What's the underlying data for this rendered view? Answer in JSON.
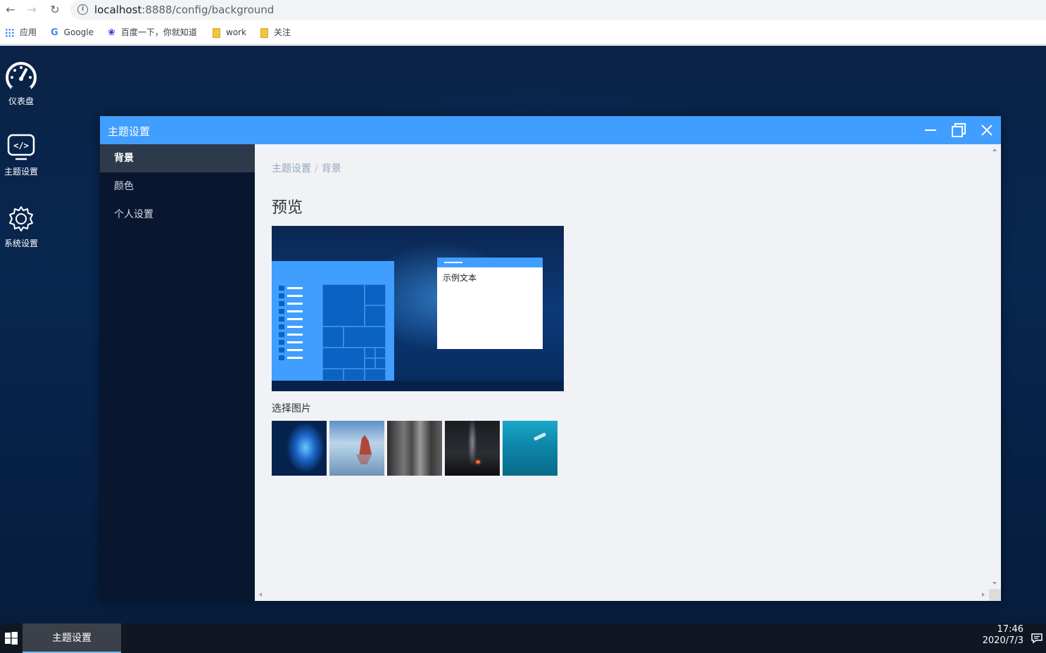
{
  "browser": {
    "url_host": "localhost",
    "url_rest": ":8888/config/background",
    "bookmarks": [
      "应用",
      "Google",
      "百度一下，你就知道",
      "work",
      "关注"
    ]
  },
  "desktop": {
    "icons": [
      {
        "label": "仪表盘",
        "icon": "dashboard-icon"
      },
      {
        "label": "主题设置",
        "icon": "code-icon"
      },
      {
        "label": "系统设置",
        "icon": "gear-icon"
      }
    ]
  },
  "window": {
    "title": "主题设置",
    "sidebar": {
      "items": [
        {
          "label": "背景",
          "active": true
        },
        {
          "label": "颜色",
          "active": false
        },
        {
          "label": "个人设置",
          "active": false
        }
      ]
    },
    "breadcrumb": {
      "root": "主题设置",
      "sep": "/",
      "current": "背景"
    },
    "preview_title": "预览",
    "preview_window_text": "示例文本",
    "choose_label": "选择图片",
    "thumbnails": [
      "windows-blue-wallpaper",
      "red-rock-beach-wallpaper",
      "grey-rock-wallpaper",
      "milky-way-campfire-wallpaper",
      "underwater-diver-wallpaper"
    ]
  },
  "taskbar": {
    "task_label": "主题设置",
    "time": "17:46",
    "date": "2020/7/3"
  },
  "colors": {
    "accent": "#409eff",
    "sidebar_bg": "#08172f",
    "sidebar_active": "#2d3a4b",
    "main_bg": "#f0f2f5"
  }
}
